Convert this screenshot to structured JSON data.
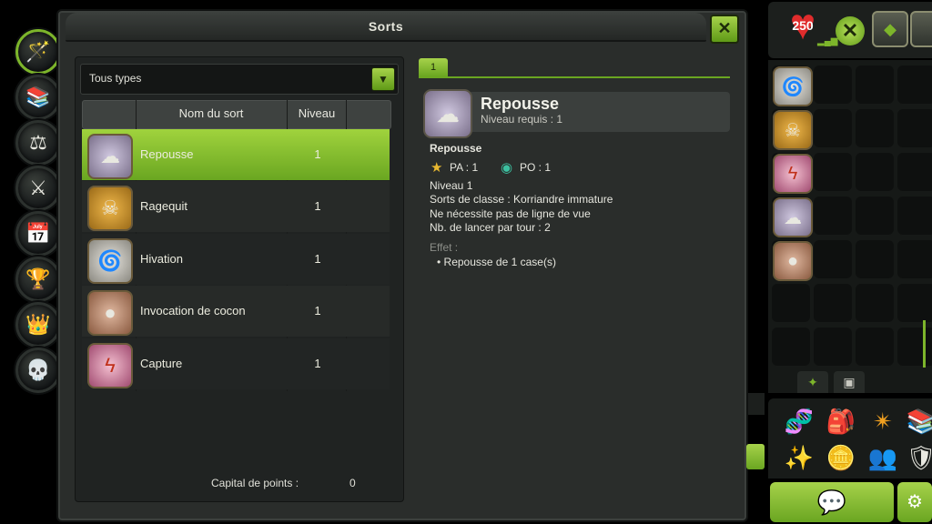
{
  "window": {
    "title": "Sorts",
    "close_label": "✕"
  },
  "filter": {
    "selected": "Tous types"
  },
  "table": {
    "headers": [
      "Nom du sort",
      "Niveau"
    ],
    "rows": [
      {
        "name": "Repousse",
        "level": "1",
        "icon": "tentacle-icon",
        "selected": true
      },
      {
        "name": "Ragequit",
        "level": "1",
        "icon": "skull-icon",
        "selected": false
      },
      {
        "name": "Hivation",
        "level": "1",
        "icon": "swirl-icon",
        "selected": false
      },
      {
        "name": "Invocation de cocon",
        "level": "1",
        "icon": "cocoon-icon",
        "selected": false
      },
      {
        "name": "Capture",
        "level": "1",
        "icon": "lightning-icon",
        "selected": false
      }
    ]
  },
  "capital": {
    "label": "Capital de points :",
    "value": "0"
  },
  "detail": {
    "tab": "1",
    "name": "Repousse",
    "required_level": "Niveau requis : 1",
    "subtitle": "Repousse",
    "pa": "PA : 1",
    "po": "PO : 1",
    "lines": [
      "Niveau 1",
      "Sorts de classe : Korriandre immature",
      "Ne nécessite pas de ligne de vue",
      "Nb. de lancer par tour : 2"
    ],
    "effect_label": "Effet :",
    "effects": [
      "• Repousse de 1 case(s)"
    ]
  },
  "hud": {
    "hp": "250"
  },
  "colors": {
    "accent": "#7db52b",
    "panel": "#2a2d2b",
    "selected_row": "#8cc433"
  }
}
